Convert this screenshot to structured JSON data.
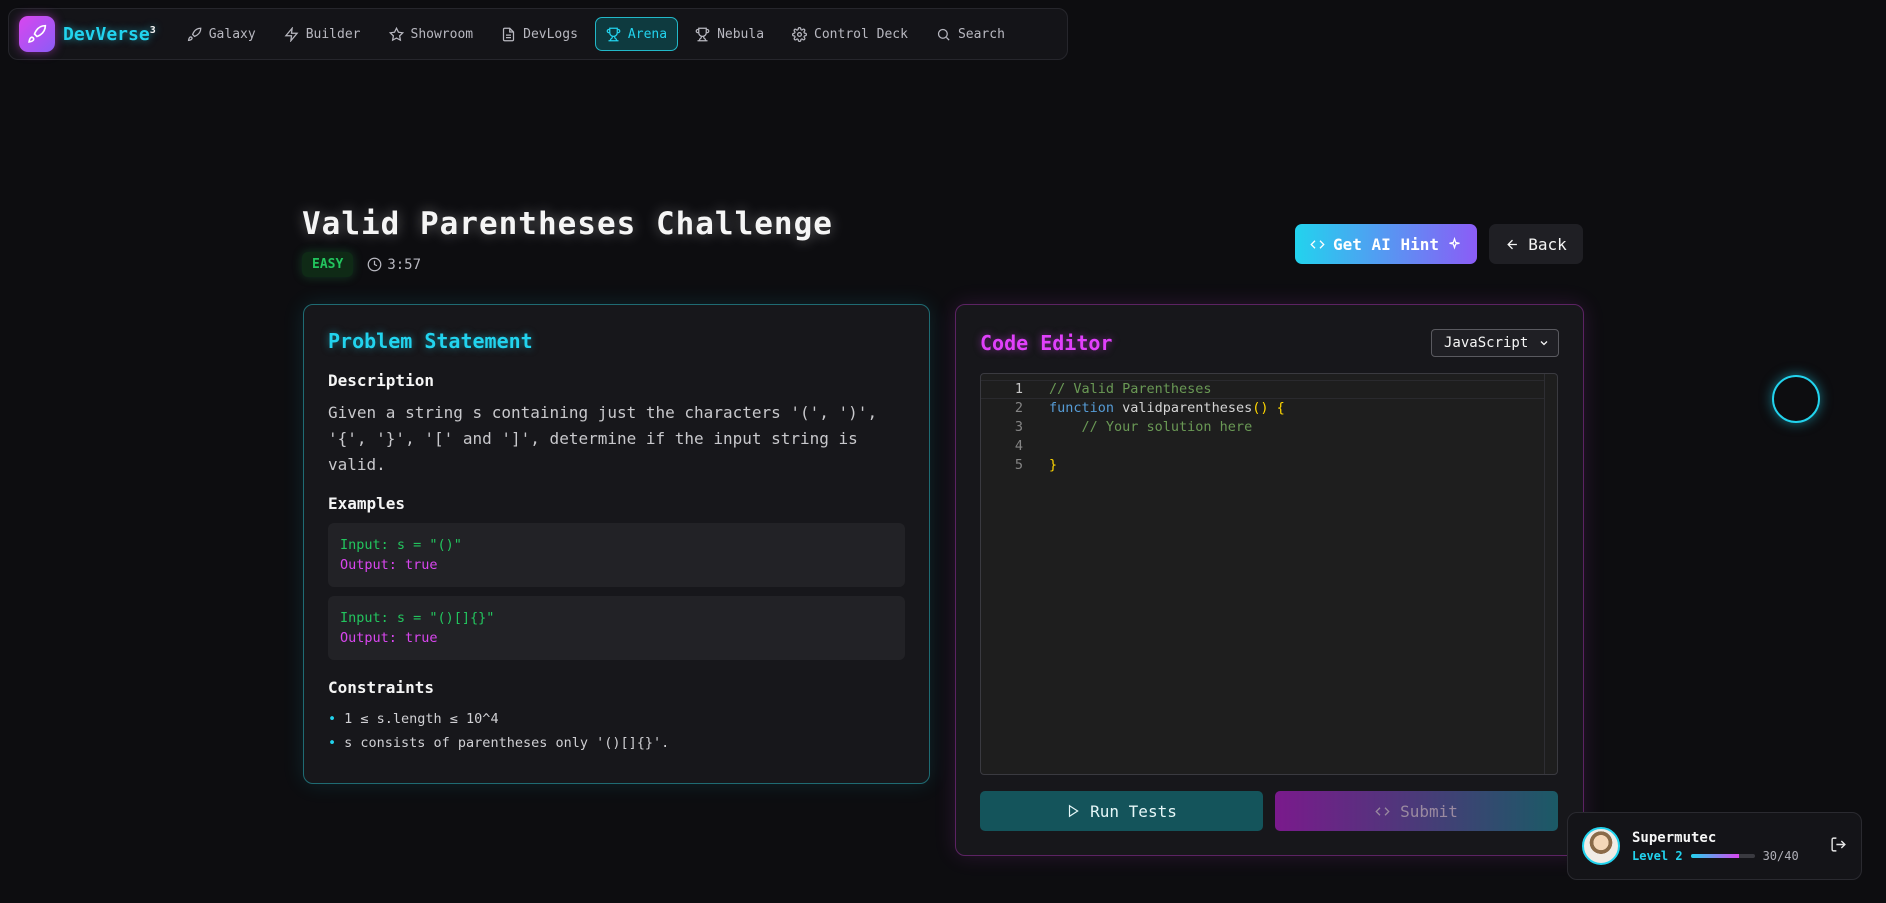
{
  "nav": {
    "brand": "DevVerse",
    "brand_sup": "3",
    "items": [
      {
        "label": "Galaxy",
        "icon": "rocket-icon",
        "active": false
      },
      {
        "label": "Builder",
        "icon": "zap-icon",
        "active": false
      },
      {
        "label": "Showroom",
        "icon": "star-icon",
        "active": false
      },
      {
        "label": "DevLogs",
        "icon": "file-icon",
        "active": false
      },
      {
        "label": "Arena",
        "icon": "trophy-icon",
        "active": true
      },
      {
        "label": "Nebula",
        "icon": "trophy-icon",
        "active": false
      },
      {
        "label": "Control Deck",
        "icon": "gear-icon",
        "active": false
      },
      {
        "label": "Search",
        "icon": "search-icon",
        "active": false
      }
    ]
  },
  "challenge": {
    "title": "Valid Parentheses Challenge",
    "difficulty": "EASY",
    "timer": "3:57"
  },
  "actions": {
    "hint": "Get AI Hint",
    "back": "Back"
  },
  "problem": {
    "heading": "Problem Statement",
    "description_heading": "Description",
    "description": "Given a string s containing just the characters '(', ')', '{', '}', '[' and ']', determine if the input string is valid.",
    "examples_heading": "Examples",
    "examples": [
      {
        "input": "Input: s = \"()\"",
        "output": "Output: true"
      },
      {
        "input": "Input: s = \"()[]{}\"",
        "output": "Output: true"
      }
    ],
    "constraints_heading": "Constraints",
    "constraints": [
      "1 ≤ s.length ≤ 10^4",
      "s consists of parentheses only '()[]{}'."
    ]
  },
  "editor": {
    "heading": "Code Editor",
    "language": "JavaScript",
    "line_numbers": [
      "1",
      "2",
      "3",
      "4",
      "5"
    ],
    "lines": {
      "l1": "// Valid Parentheses",
      "l2_kw": "function",
      "l2_name": " validparentheses",
      "l2_br": "() {",
      "l3": "    // Your solution here",
      "l5": "}"
    },
    "run_label": "Run Tests",
    "submit_label": "Submit"
  },
  "user": {
    "name": "Supermutec",
    "level": "Level 2",
    "xp": "30/40",
    "xp_fraction": 0.75
  },
  "colors": {
    "accent_cyan": "#22d3ee",
    "accent_magenta": "#d946ef",
    "easy_green": "#22c55e"
  }
}
